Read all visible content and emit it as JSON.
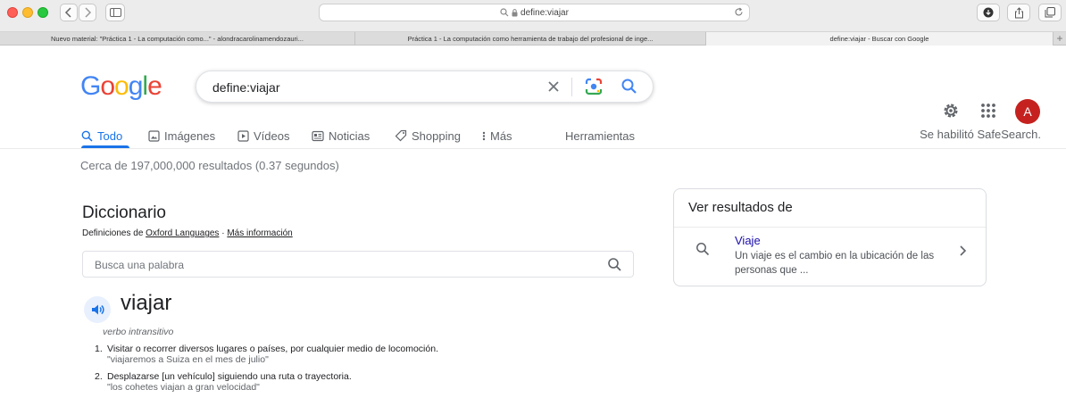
{
  "browser": {
    "url": "define:viajar",
    "tabs": [
      {
        "label": "Nuevo material: \"Práctica 1 - La computación como...\" - alondracarolinamendozauri..."
      },
      {
        "label": "Práctica 1 - La computación como herramienta de trabajo del profesional de inge..."
      },
      {
        "label": "define:viajar - Buscar con Google"
      }
    ],
    "new_tab_label": "+"
  },
  "search": {
    "query": "define:viajar"
  },
  "logo": {
    "letters": [
      "G",
      "o",
      "o",
      "g",
      "l",
      "e"
    ],
    "colors": [
      "#4285F4",
      "#EA4335",
      "#FBBC05",
      "#4285F4",
      "#34A853",
      "#EA4335"
    ]
  },
  "user": {
    "avatar_letter": "A",
    "avatar_color": "#c5221f"
  },
  "nav": {
    "items": [
      {
        "label": "Todo",
        "icon": "search-icon",
        "active": true
      },
      {
        "label": "Imágenes",
        "icon": "image-icon"
      },
      {
        "label": "Vídeos",
        "icon": "video-icon"
      },
      {
        "label": "Noticias",
        "icon": "news-icon"
      },
      {
        "label": "Shopping",
        "icon": "tag-icon"
      },
      {
        "label": "Más",
        "icon": "more-vert-icon"
      }
    ],
    "tools": "Herramientas",
    "safesearch": "Se habilitó SafeSearch."
  },
  "results": {
    "count_text": "Cerca de 197,000,000 resultados (0.37 segundos)"
  },
  "dictionary": {
    "title": "Diccionario",
    "source_prefix": "Definiciones de",
    "source_name": "Oxford Languages",
    "source_sep": "·",
    "more_info": "Más información",
    "search_placeholder": "Busca una palabra",
    "headword": "viajar",
    "part_of_speech": "verbo intransitivo",
    "definitions": [
      {
        "number": "1.",
        "text": "Visitar o recorrer diversos lugares o países, por cualquier medio de locomoción.",
        "example": "\"viajaremos a Suiza en el mes de julio\""
      },
      {
        "number": "2.",
        "text": "Desplazarse [un vehículo] siguiendo una ruta o trayectoria.",
        "example": "\"los cohetes viajan a gran velocidad\""
      }
    ]
  },
  "panel": {
    "title": "Ver resultados de",
    "link": "Viaje",
    "description": "Un viaje es el cambio en la ubicación de las personas que ..."
  },
  "colors": {
    "accent": "#1a73e8",
    "link": "#1a0dab"
  }
}
